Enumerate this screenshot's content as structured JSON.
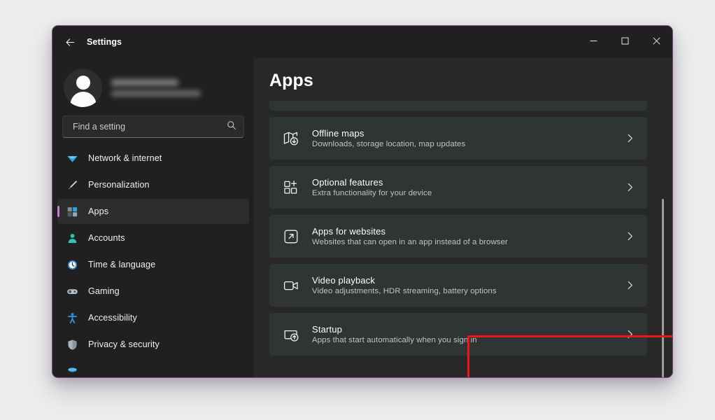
{
  "window": {
    "title": "Settings",
    "back_icon": "back-arrow-icon",
    "controls": {
      "minimize": "minimize-icon",
      "maximize": "maximize-icon",
      "close": "close-icon"
    },
    "border_color": "#7d4b86"
  },
  "account": {
    "name_redacted": "█████ ██████",
    "email_redacted": "█████████@█████.███",
    "avatar_icon": "default-user-avatar-icon"
  },
  "search": {
    "placeholder": "Find a setting",
    "value": "",
    "icon": "search-icon"
  },
  "sidebar": {
    "items": [
      {
        "label": "Network & internet",
        "icon": "network-icon",
        "selected": false
      },
      {
        "label": "Personalization",
        "icon": "paintbrush-icon",
        "selected": false
      },
      {
        "label": "Apps",
        "icon": "apps-grid-icon",
        "selected": true
      },
      {
        "label": "Accounts",
        "icon": "person-icon",
        "selected": false
      },
      {
        "label": "Time & language",
        "icon": "clock-icon",
        "selected": false
      },
      {
        "label": "Gaming",
        "icon": "gamepad-icon",
        "selected": false
      },
      {
        "label": "Accessibility",
        "icon": "accessibility-person-icon",
        "selected": false
      },
      {
        "label": "Privacy & security",
        "icon": "shield-icon",
        "selected": false
      },
      {
        "label": "",
        "icon": "windows-update-icon",
        "selected": false
      }
    ],
    "selected_accent": "#c77fd6"
  },
  "main": {
    "page_title": "Apps",
    "settings_cards": [
      {
        "title": "Offline maps",
        "subtitle": "Downloads, storage location, map updates",
        "icon": "offline-maps-icon",
        "chevron": "chevron-right-icon",
        "highlighted": false
      },
      {
        "title": "Optional features",
        "subtitle": "Extra functionality for your device",
        "icon": "optional-features-icon",
        "chevron": "chevron-right-icon",
        "highlighted": false
      },
      {
        "title": "Apps for websites",
        "subtitle": "Websites that can open in an app instead of a browser",
        "icon": "apps-for-websites-icon",
        "chevron": "chevron-right-icon",
        "highlighted": false
      },
      {
        "title": "Video playback",
        "subtitle": "Video adjustments, HDR streaming, battery options",
        "icon": "video-playback-icon",
        "chevron": "chevron-right-icon",
        "highlighted": false
      },
      {
        "title": "Startup",
        "subtitle": "Apps that start automatically when you sign in",
        "icon": "startup-icon",
        "chevron": "chevron-right-icon",
        "highlighted": true
      }
    ]
  },
  "annotation": {
    "highlight_color": "#f51414",
    "target": "Startup"
  },
  "scrollbar": {
    "orientation": "vertical",
    "thumb_color": "#9c9c9c"
  }
}
